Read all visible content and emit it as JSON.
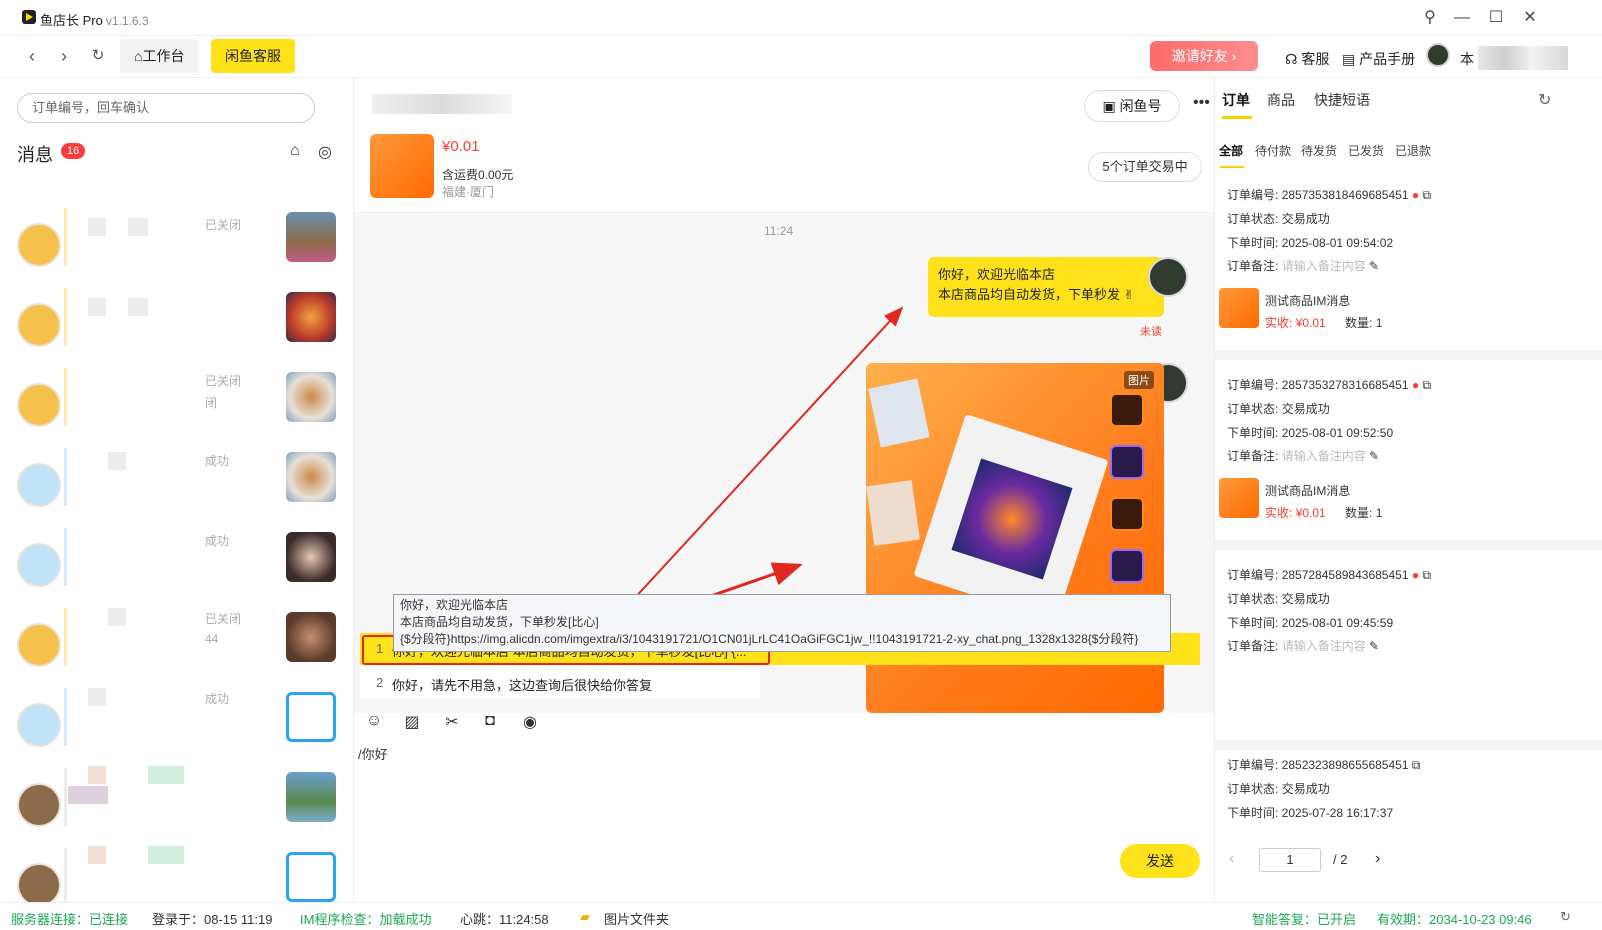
{
  "window": {
    "title": "鱼店长 Pro",
    "version": "v1.1.6.3"
  },
  "toolbar": {
    "workbench_label": "工作台",
    "service_label": "闲鱼客服",
    "invite_label": "邀请好友",
    "support_label": "客服",
    "manual_label": "产品手册",
    "user_initial": "本"
  },
  "sidebar": {
    "search_placeholder": "订单编号，回车确认",
    "messages_label": "消息",
    "messages_badge": "16",
    "conversations": [
      {
        "status": "已关闭"
      },
      {
        "status": ""
      },
      {
        "status": "已关闭",
        "status2": "闭"
      },
      {
        "status": "成功"
      },
      {
        "status": "成功"
      },
      {
        "status": "已关闭",
        "status2": "44"
      },
      {
        "status": "成功"
      },
      {
        "status": ""
      },
      {
        "status": ""
      }
    ]
  },
  "chat": {
    "xianyu_button": "闲鱼号",
    "product_price": "¥0.01",
    "product_shipping": "含运费0.00元",
    "product_location": "福建·厦门",
    "trade_button": "5个订单交易中",
    "time": "11:24",
    "bubble_line1": "你好，欢迎光临本店",
    "bubble_line2": "本店商品均自动发货，下单秒发",
    "unread": "未读",
    "image_tag": "图片",
    "suggestions": [
      {
        "index": "1",
        "text": "你好，欢迎光临本店 本店商品均自动发货，下单秒发[比心] {..."
      },
      {
        "index": "2",
        "text": "你好，请先不用急，这边查询后很快给你答复"
      }
    ],
    "tooltip_line1": "你好，欢迎光临本店",
    "tooltip_line2": "本店商品均自动发货，下单秒发[比心]",
    "tooltip_line3": "{$分段符}https://img.alicdn.com/imgextra/i3/1043191721/O1CN01jLrLC41OaGiFGC1jw_!!1043191721-2-xy_chat.png_1328x1328{$分段符}",
    "input_text": "/你好",
    "send_label": "发送"
  },
  "right": {
    "tabs": [
      "订单",
      "商品",
      "快捷短语"
    ],
    "filters": [
      "全部",
      "待付款",
      "待发货",
      "已发货",
      "已退款"
    ],
    "labels": {
      "order_no": "订单编号:",
      "status": "订单状态:",
      "time": "下单时间:",
      "note": "订单备注:",
      "paid": "实收:",
      "qty": "数量:"
    },
    "note_placeholder": "请输入备注内容",
    "orders": [
      {
        "no": "2857353818469685451",
        "status": "交易成功",
        "time": "2025-08-01 09:54:02",
        "product": "测试商品IM消息",
        "price": "¥0.01",
        "qty": "1"
      },
      {
        "no": "2857353278316685451",
        "status": "交易成功",
        "time": "2025-08-01 09:52:50",
        "product": "测试商品IM消息",
        "price": "¥0.01",
        "qty": "1"
      },
      {
        "no": "2857284589843685451",
        "status": "交易成功",
        "time": "2025-08-01 09:45:59"
      },
      {
        "no": "2852323898655685451",
        "status": "交易成功",
        "time": "2025-07-28 16:17:37"
      }
    ],
    "page_current": "1",
    "page_total": "/ 2"
  },
  "statusbar": {
    "server_label": "服务器连接：已连接",
    "login_label": "登录于：08-15 11:19",
    "im_label": "IM程序检查：加载成功",
    "heartbeat_label": "心跳：11:24:58",
    "folder_label": "图片文件夹",
    "smart_reply_label": "智能答复：已开启",
    "expiry_label": "有效期：2034-10-23 09:46"
  },
  "colors": {
    "accent": "#ffe21a",
    "invite": "#ff6b6b",
    "price": "#ff3b30",
    "green": "#1aaa55"
  }
}
